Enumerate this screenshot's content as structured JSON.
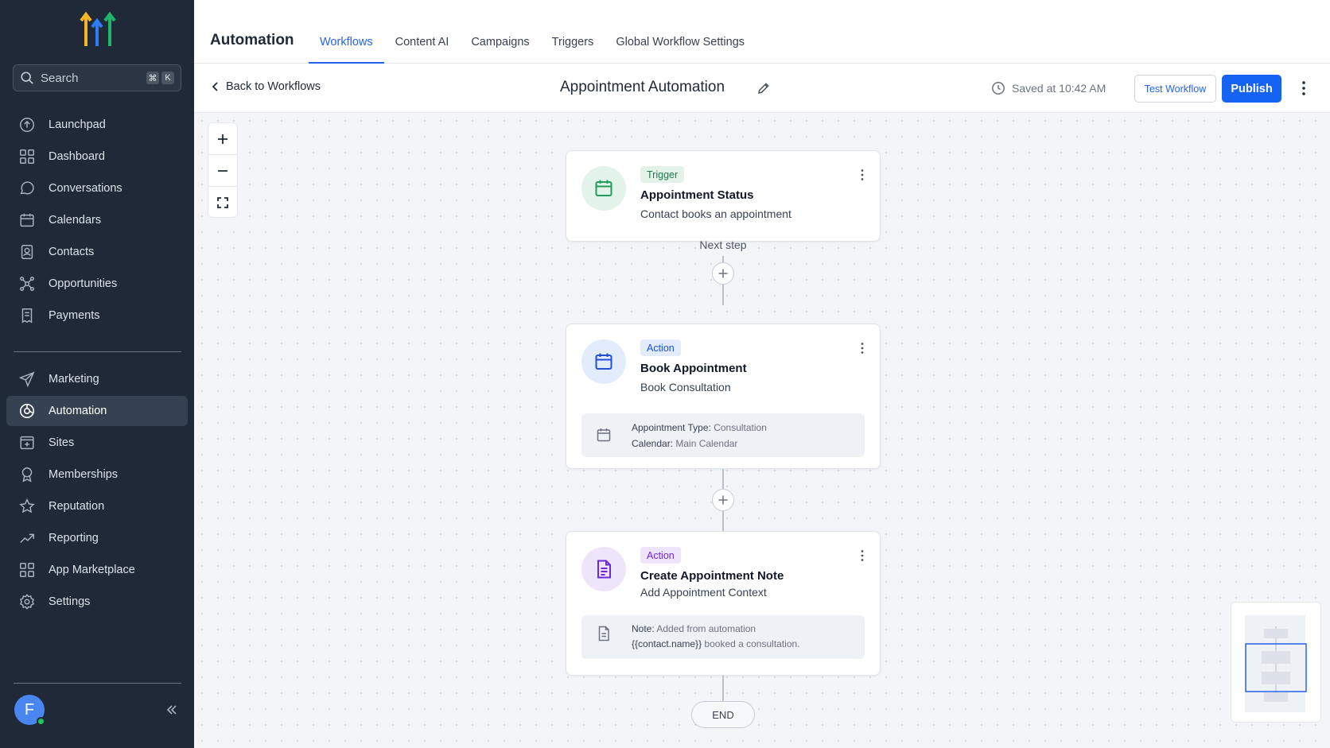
{
  "sidebar": {
    "search": {
      "placeholder": "Search",
      "shortcut_keys": [
        "⌘",
        "K"
      ]
    },
    "nav_primary": [
      {
        "label": "Launchpad",
        "icon": "launchpad-icon"
      },
      {
        "label": "Dashboard",
        "icon": "dashboard-icon"
      },
      {
        "label": "Conversations",
        "icon": "chat-bubble-icon"
      },
      {
        "label": "Calendars",
        "icon": "calendar-icon"
      },
      {
        "label": "Contacts",
        "icon": "contacts-icon"
      },
      {
        "label": "Opportunities",
        "icon": "opportunities-icon"
      },
      {
        "label": "Payments",
        "icon": "receipt-icon"
      }
    ],
    "nav_secondary": [
      {
        "label": "Marketing",
        "icon": "send-icon"
      },
      {
        "label": "Automation",
        "icon": "automation-icon",
        "active": true
      },
      {
        "label": "Sites",
        "icon": "sites-icon"
      },
      {
        "label": "Memberships",
        "icon": "award-icon"
      },
      {
        "label": "Reputation",
        "icon": "star-icon"
      },
      {
        "label": "Reporting",
        "icon": "trend-icon"
      },
      {
        "label": "App Marketplace",
        "icon": "apps-grid-icon"
      },
      {
        "label": "Settings",
        "icon": "gear-icon"
      }
    ],
    "user_initial": "F"
  },
  "header": {
    "title": "Automation",
    "tabs": [
      {
        "label": "Workflows",
        "active": true
      },
      {
        "label": "Content AI"
      },
      {
        "label": "Campaigns"
      },
      {
        "label": "Triggers"
      },
      {
        "label": "Global Workflow Settings"
      }
    ]
  },
  "subheader": {
    "back_label": "Back to Workflows",
    "workflow_title": "Appointment Automation",
    "saved_text": "Saved at 10:42 AM",
    "test_label": "Test Workflow",
    "publish_label": "Publish"
  },
  "workflow": {
    "trigger": {
      "badge": "Trigger",
      "title": "Appointment Status",
      "subtitle": "Contact books an appointment"
    },
    "next_step_label": "Next step",
    "action1": {
      "badge": "Action",
      "title": "Book Appointment",
      "subtitle": "Book Consultation",
      "detail_type_label": "Appointment Type:",
      "detail_type_value": "Consultation",
      "detail_calendar_label": "Calendar:",
      "detail_calendar_value": "Main Calendar"
    },
    "action2": {
      "badge": "Action",
      "title": "Create Appointment Note",
      "subtitle": "Add Appointment Context",
      "note_label": "Note:",
      "note_line1": "Added from automation",
      "note_token": "{{contact.name}}",
      "note_line2": "booked a consultation."
    },
    "end_label": "END"
  },
  "colors": {
    "sidebar_bg": "#1f2937",
    "accent": "#2563eb",
    "publish": "#1463f3",
    "trigger_badge_bg": "#e3f3ea",
    "trigger_badge_fg": "#1f7a4b",
    "action_blue_bg": "#e3ecfd",
    "action_purple_bg": "#efe5fb"
  }
}
